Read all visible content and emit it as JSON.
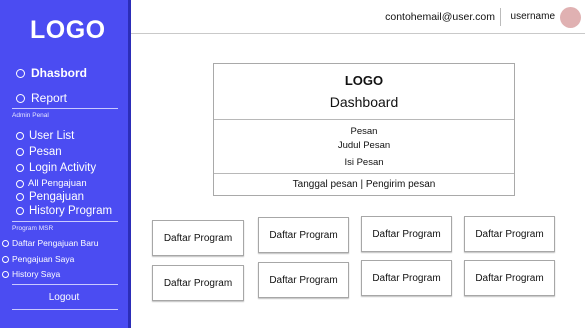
{
  "sidebar": {
    "logo": "LOGO",
    "items": [
      {
        "label": "Dhasbord"
      },
      {
        "label": "Report"
      }
    ],
    "admin_section": "Admin Penal",
    "admin_items": [
      {
        "label": "User List"
      },
      {
        "label": "Pesan"
      },
      {
        "label": "Login Activity"
      },
      {
        "label": "All Pengajuan"
      },
      {
        "label": "Pengajuan"
      },
      {
        "label": "History Program"
      }
    ],
    "program_section": "Program MSR",
    "program_items": [
      {
        "label": "Daftar Pengajuan Baru"
      },
      {
        "label": "Pengajuan Saya"
      },
      {
        "label": "History Saya"
      }
    ],
    "logout": "Logout",
    "colors": {
      "background": "#4b4cf2",
      "text": "#ffffff"
    }
  },
  "header": {
    "email": "contohemail@user.com",
    "username": "username",
    "avatar_color": "#e0b1b2"
  },
  "card": {
    "logo": "LOGO",
    "title": "Dashboard",
    "pesan": "Pesan",
    "judul": "Judul Pesan",
    "isi": "Isi Pesan",
    "footer": "Tanggal pesan | Pengirim pesan"
  },
  "programs": [
    "Daftar Program",
    "Daftar Program",
    "Daftar Program",
    "Daftar Program",
    "Daftar Program",
    "Daftar Program",
    "Daftar Program",
    "Daftar Program"
  ]
}
